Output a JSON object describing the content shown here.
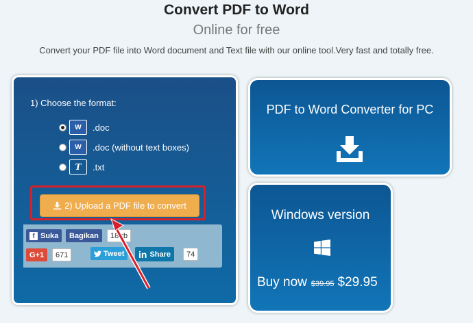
{
  "header": {
    "title": "Convert PDF to Word",
    "subtitle": "Online for free",
    "description": "Convert your PDF file into Word document and Text file with our online tool.Very fast and totally free."
  },
  "converter": {
    "choose_label": "1) Choose the format:",
    "options": [
      {
        "label": ".doc",
        "icon": "word-doc-icon",
        "selected": true
      },
      {
        "label": ".doc (without text boxes)",
        "icon": "word-doc-icon",
        "selected": false
      },
      {
        "label": ".txt",
        "icon": "text-file-icon",
        "selected": false
      }
    ],
    "word_icon_text": "W",
    "txt_icon_text": "T",
    "upload_label": "2) Upload a PDF file to convert"
  },
  "social": {
    "fb_like": "Suka",
    "fb_share": "Bagikan",
    "fb_count": "18 rb",
    "gplus_label": "G+1",
    "gplus_count": "671",
    "tweet_label": "Tweet",
    "linkedin_label": "Share",
    "linkedin_count": "74"
  },
  "pc_card": {
    "title": "PDF to Word Converter for PC"
  },
  "windows_card": {
    "title": "Windows version",
    "buy_label": "Buy now",
    "old_price": "$39.95",
    "new_price": "$29.95"
  },
  "colors": {
    "panel_blue": "#1b4f87",
    "upload_orange": "#f0ad4e",
    "highlight_red": "#d8202a",
    "facebook": "#3b5998",
    "gplus": "#dd4b39",
    "twitter": "#2c9fd9",
    "linkedin": "#0e76a8"
  }
}
